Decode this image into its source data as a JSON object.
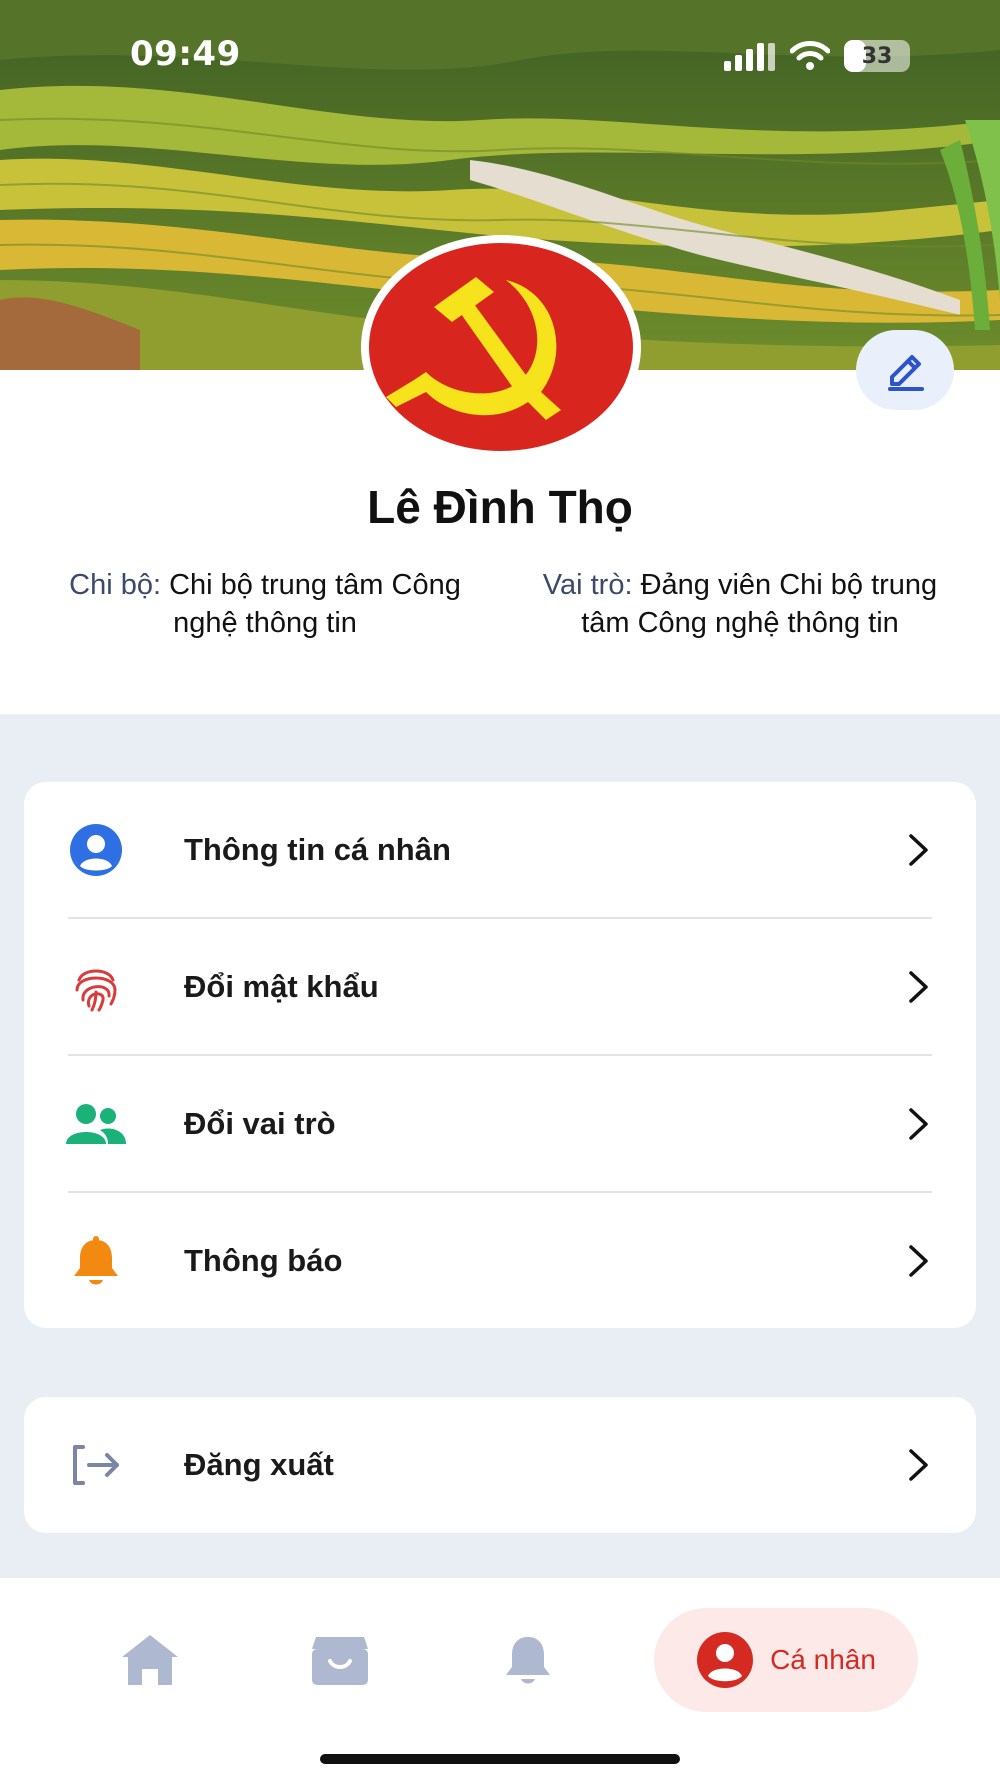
{
  "status_bar": {
    "time": "09:49",
    "battery": "33",
    "battery_level": 0.33
  },
  "profile": {
    "name": "Lê Đình Thọ",
    "branch_label": "Chi bộ:",
    "branch_value": "Chi bộ trung tâm Công nghệ thông tin",
    "role_label": "Vai trò:",
    "role_value": "Đảng viên Chi bộ trung tâm Công nghệ thông tin"
  },
  "menu": {
    "items": [
      {
        "label": "Thông tin cá nhân",
        "icon": "user-circle-icon",
        "color": "#2f6fe4"
      },
      {
        "label": "Đổi mật khẩu",
        "icon": "fingerprint-icon",
        "color": "#d93b3b"
      },
      {
        "label": "Đổi vai trò",
        "icon": "users-icon",
        "color": "#1bb27a"
      },
      {
        "label": "Thông báo",
        "icon": "bell-icon",
        "color": "#f28a12"
      }
    ],
    "logout_label": "Đăng xuất"
  },
  "bottom_nav": {
    "items": [
      {
        "icon": "home-icon"
      },
      {
        "icon": "archive-box-icon"
      },
      {
        "icon": "bell-icon"
      },
      {
        "icon": "user-circle-icon",
        "label": "Cá nhân",
        "active": true
      }
    ]
  },
  "colors": {
    "accent": "#d42a22",
    "flag_red": "#d8261f",
    "emblem_yellow": "#f7e31c",
    "background": "#e9eef5"
  }
}
